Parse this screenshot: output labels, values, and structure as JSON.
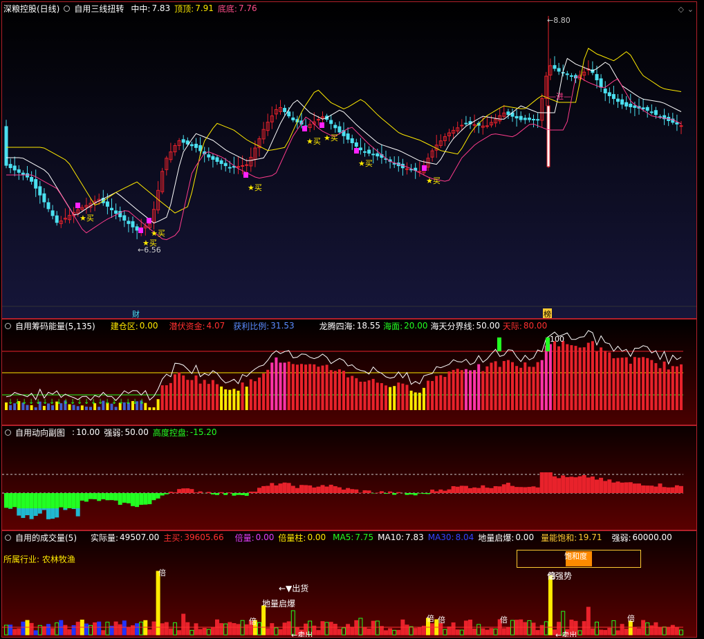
{
  "panel1": {
    "title": "深粮控股(日线)",
    "indicator": "自用三线扭转",
    "zz_label": "中中:",
    "zz_value": "7.83",
    "dd_label": "顶顶:",
    "dd_value": "7.91",
    "di_label": "底底:",
    "di_value": "7.76",
    "high_label": "8.80",
    "low_label": "6.56",
    "buy_label": "★买",
    "event_left": "财",
    "event_right": "榜",
    "jin_label": "进",
    "corner_icons": [
      "diamond-icon",
      "chevron-down-icon"
    ],
    "colors": {
      "bg_top": "#000000",
      "bg_bottom": "#16163a",
      "up": "#e8222b",
      "down": "#4be0f0",
      "ma1": "#ffffff",
      "ma2": "#ffea00",
      "ma3": "#ff3c8c"
    }
  },
  "panel2": {
    "indicator": "自用筹码能量(5,135)",
    "jcq_label": "建仓区:",
    "jcq_value": "0.00",
    "qfzj_label": "潜伏资金:",
    "qfzj_value": "4.07",
    "hlbl_label": "获利比例:",
    "hlbl_value": "31.53",
    "lt_label": "龙腾四海:",
    "lt_value": "18.55",
    "hm_label": "海面:",
    "hm_value": "20.00",
    "htf_label": "海天分界线:",
    "htf_value": "50.00",
    "tj_label": "天际:",
    "tj_value": "80.00",
    "peak_label": "100"
  },
  "panel3": {
    "indicator": "自用动向副图",
    "v1_label": ":",
    "v1_value": "10.00",
    "qr_label": "强弱:",
    "qr_value": "50.00",
    "gd_label": "高度控盘:",
    "gd_value": "-15.20"
  },
  "panel4": {
    "indicator": "自用的成交量(5)",
    "sjl_label": "实际量:",
    "sjl_value": "49507.00",
    "zm_label": "主买:",
    "zm_value": "39605.66",
    "bl_label": "倍量:",
    "bl_value": "0.00",
    "blz_label": "倍量柱:",
    "blz_value": "0.00",
    "ma5_label": "MA5:",
    "ma5_value": "7.75",
    "ma10_label": "MA10:",
    "ma10_value": "7.83",
    "ma30_label": "MA30:",
    "ma30_value": "8.04",
    "dl_label": "地量启爆:",
    "dl_value": "0.00",
    "lnbh_label": "量能饱和:",
    "lnbh_value": "19.71",
    "qr_label": "强弱:",
    "qr_value": "60000.00",
    "industry_label": "所属行业:",
    "industry_value": "农林牧渔",
    "saturation_label": "饱和度",
    "bei_label": "倍",
    "chuhuo_label": "←▼出货",
    "dlqb_label": "地量启爆",
    "mai_label": "←卖出",
    "qiangshi_label": "倍强势"
  }
}
